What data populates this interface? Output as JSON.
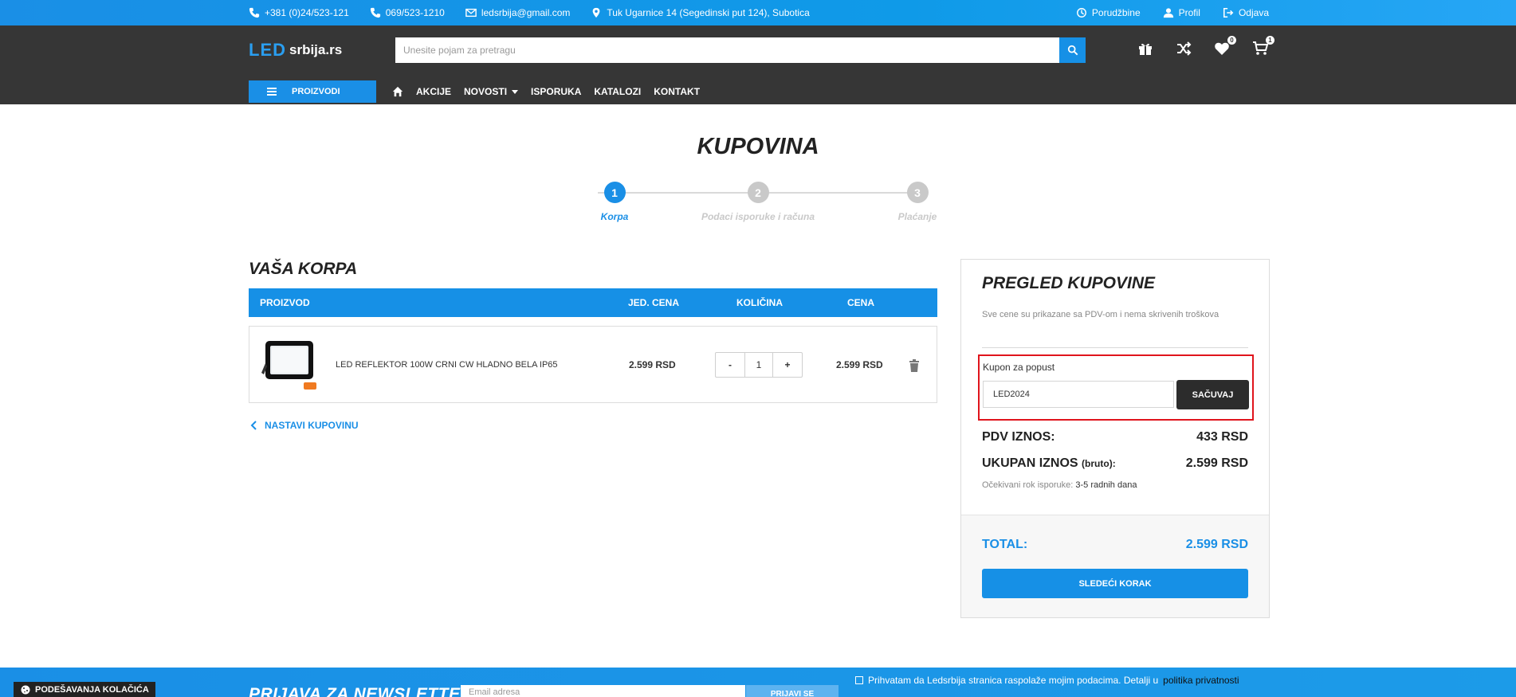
{
  "topbar": {
    "phone1": "+381 (0)24/523-121",
    "phone2": "069/523-1210",
    "email": "ledsrbija@gmail.com",
    "address": "Tuk Ugarnice 14 (Segedinski put 124), Subotica",
    "orders": "Porudžbine",
    "profile": "Profil",
    "logout": "Odjava"
  },
  "header": {
    "logo_led": "LED",
    "logo_text": "srbija.rs",
    "search_placeholder": "Unesite pojam za pretragu",
    "wishlist_count": "0",
    "cart_count": "1"
  },
  "nav": {
    "products": "PROIZVODI",
    "items": [
      "AKCIJE",
      "NOVOSTI",
      "ISPORUKA",
      "KATALOZI",
      "KONTAKT"
    ]
  },
  "page_title": "KUPOVINA",
  "steps": [
    {
      "number": "1",
      "label": "Korpa"
    },
    {
      "number": "2",
      "label": "Podaci isporuke i računa"
    },
    {
      "number": "3",
      "label": "Plaćanje"
    }
  ],
  "cart": {
    "title": "VAŠA KORPA",
    "columns": [
      "PROIZVOD",
      "JED. CENA",
      "KOLIČINA",
      "CENA"
    ],
    "items": [
      {
        "name": "LED REFLEKTOR 100W CRNI CW HLADNO BELA IP65",
        "unit_price": "2.599 RSD",
        "quantity": "1",
        "price": "2.599 RSD"
      }
    ],
    "qty_minus": "-",
    "qty_plus": "+",
    "continue": "NASTAVI KUPOVINU"
  },
  "summary": {
    "title": "PREGLED KUPOVINE",
    "subtitle": "Sve cene su prikazane sa PDV-om i nema skrivenih troškova",
    "coupon_label": "Kupon za popust",
    "coupon_value": "LED2024",
    "coupon_button": "SAČUVAJ",
    "pdv_label": "PDV IZNOS:",
    "pdv_value": "433 RSD",
    "total_gross_label": "UKUPAN IZNOS",
    "total_gross_suffix": "(bruto):",
    "total_gross_value": "2.599 RSD",
    "delivery_label": "Očekivani rok isporuke:",
    "delivery_value": "3-5 radnih dana",
    "total_label": "TOTAL:",
    "total_value": "2.599 RSD",
    "next_button": "SLEDEĆI KORAK"
  },
  "footer": {
    "cookie": "PODEŠAVANJA KOLAČIĆA",
    "newsletter": "PRIJAVA ZA NEWSLETTER",
    "nl_placeholder": "Email adresa",
    "nl_button": "PRIJAVI SE",
    "privacy_text": "Prihvatam da Ledsrbija stranica raspolaže mojim podacima. Detalji u",
    "privacy_link": "politika privatnosti",
    "privacy_end": "."
  },
  "colors": {
    "accent": "#1690e6",
    "header_bg": "#363636",
    "coupon_highlight": "#e0141c"
  }
}
